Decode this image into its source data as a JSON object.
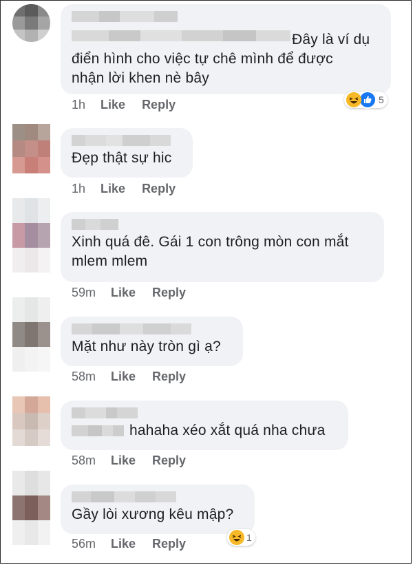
{
  "comments": [
    {
      "text": "Đây là ví dụ\nđiển hình cho việc tự chê mình để được\nnhận lời khen nè bây",
      "time": "1h",
      "like": "Like",
      "reply": "Reply",
      "reaction_count": "5"
    },
    {
      "text": "Đẹp thật sự hic",
      "time": "1h",
      "like": "Like",
      "reply": "Reply"
    },
    {
      "text": "Xinh quá đê. Gái 1 con trông mòn con mắt\nmlem mlem",
      "time": "59m",
      "like": "Like",
      "reply": "Reply"
    },
    {
      "text": "Mặt như này tròn gì ạ?",
      "time": "58m",
      "like": "Like",
      "reply": "Reply"
    },
    {
      "text": "hahaha xéo xắt quá nha chưa",
      "time": "58m",
      "like": "Like",
      "reply": "Reply"
    },
    {
      "text": "Gầy lòi xương kêu mập?",
      "time": "56m",
      "like": "Like",
      "reply": "Reply",
      "reaction_count": "1"
    }
  ],
  "colors": {
    "bubble": "#f0f2f5",
    "meta": "#65676b",
    "text": "#1c1e21",
    "haha": "#f7b928",
    "like": "#1877f2"
  },
  "icons": [
    "haha-reaction-icon",
    "like-reaction-icon"
  ]
}
